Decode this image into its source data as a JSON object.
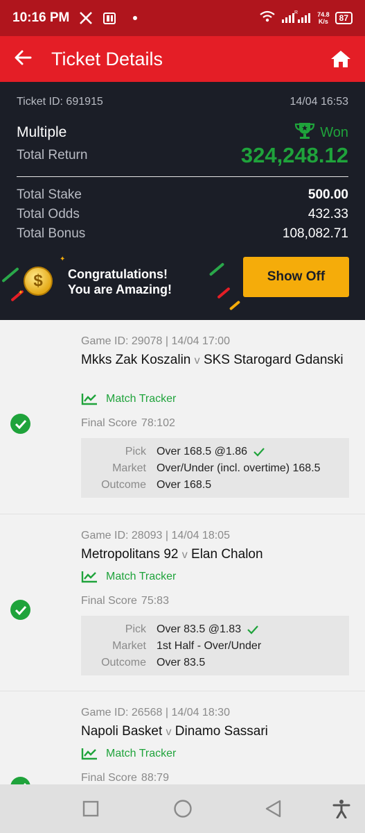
{
  "status_bar": {
    "time": "10:16 PM",
    "speed_value": "74.8",
    "speed_unit": "K/s",
    "battery": "87"
  },
  "header": {
    "title": "Ticket Details"
  },
  "summary": {
    "ticket_id": "Ticket ID: 691915",
    "datetime": "14/04 16:53",
    "bet_type": "Multiple",
    "status": "Won",
    "total_return_label": "Total Return",
    "total_return": "324,248.12",
    "stake_label": "Total Stake",
    "stake": "500.00",
    "odds_label": "Total Odds",
    "odds": "432.33",
    "bonus_label": "Total Bonus",
    "bonus": "108,082.71"
  },
  "banner": {
    "line1": "Congratulations!",
    "line2": "You are Amazing!",
    "button": "Show Off"
  },
  "labels": {
    "match_tracker": "Match Tracker",
    "final_score": "Final Score",
    "pick": "Pick",
    "market": "Market",
    "outcome": "Outcome",
    "vs": "v"
  },
  "games": [
    {
      "id_line": "Game ID: 29078 | 14/04 17:00",
      "home": "Mkks Zak Koszalin",
      "away": "SKS Starogard Gdanski",
      "score": "78:102",
      "pick": "Over 168.5 @1.86",
      "market": "Over/Under (incl. overtime) 168.5",
      "outcome": "Over 168.5"
    },
    {
      "id_line": "Game ID: 28093 | 14/04 18:05",
      "home": "Metropolitans 92",
      "away": "Elan Chalon",
      "score": "75:83",
      "pick": "Over 83.5 @1.83",
      "market": "1st Half - Over/Under",
      "outcome": "Over 83.5"
    },
    {
      "id_line": "Game ID: 26568 | 14/04 18:30",
      "home": "Napoli Basket",
      "away": "Dinamo Sassari",
      "score": "88:79",
      "pick": "",
      "market": "",
      "outcome": ""
    }
  ],
  "colors": {
    "brand_red": "#e41e26",
    "status_red": "#b0151d",
    "won_green": "#1fa33b",
    "dark_bg": "#1b1e27",
    "accent_yellow": "#f5ac0a"
  },
  "icons": [
    "back-arrow-icon",
    "home-icon",
    "trophy-icon",
    "chart-line-icon",
    "check-circle-icon",
    "checkmark-icon",
    "coin-icon",
    "square-nav-icon",
    "circle-nav-icon",
    "triangle-back-nav-icon",
    "accessibility-icon"
  ]
}
